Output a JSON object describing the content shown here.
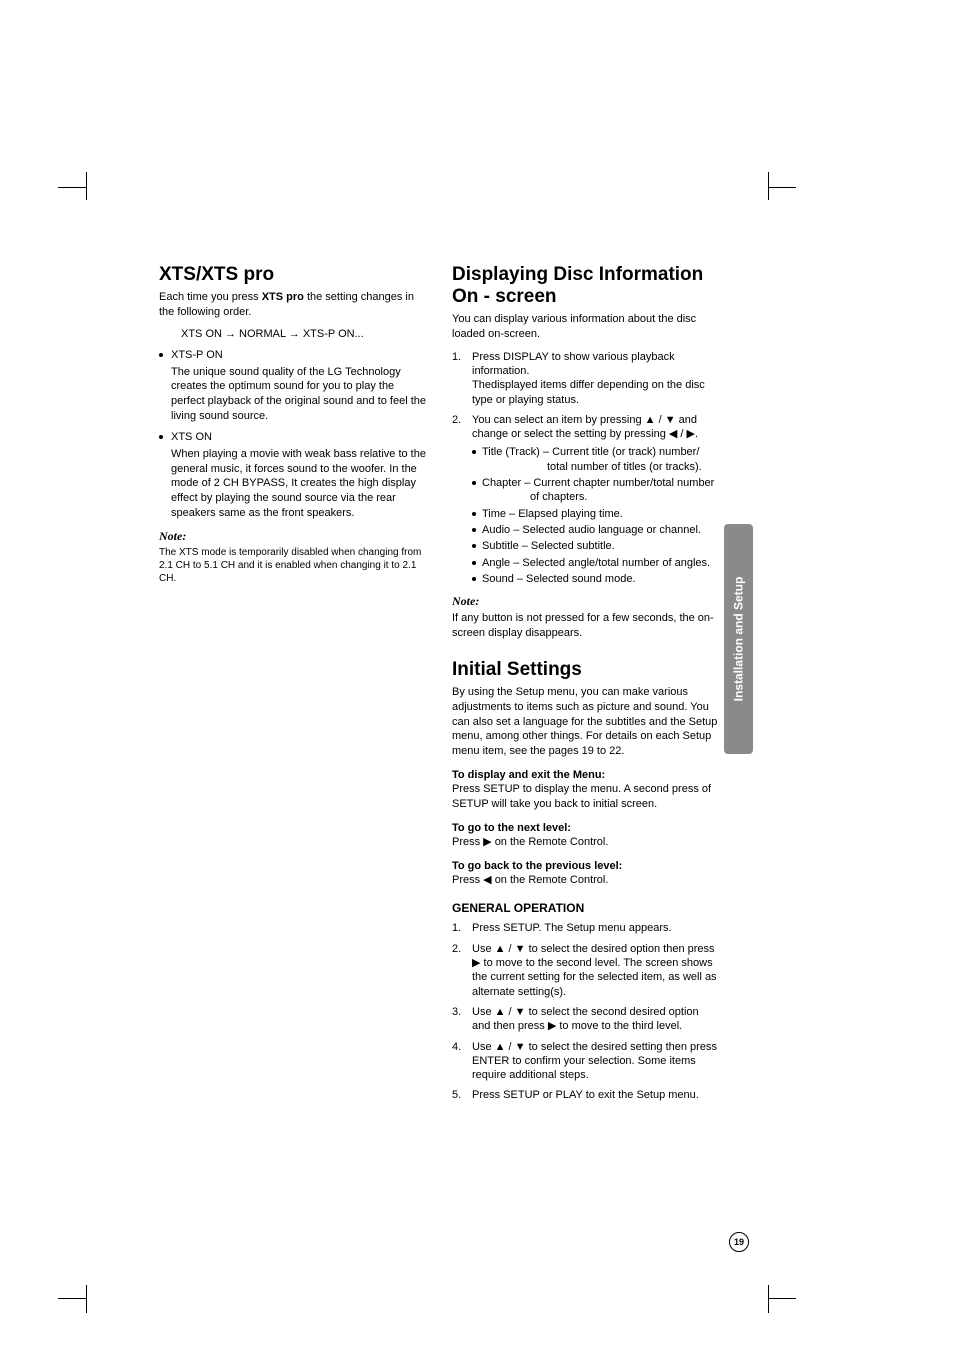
{
  "left": {
    "heading": "XTS/XTS pro",
    "intro": "Each time you press XTS pro the setting changes in the following order.",
    "intro_bold": "XTS pro",
    "sequence": "XTS ON → NORMAL → XTS-P ON...",
    "bullets": [
      {
        "title": "XTS-P ON",
        "desc": "The unique sound quality of the LG Technology creates the optimum sound for you to play the perfect playback of the original sound and to feel the living sound source."
      },
      {
        "title": "XTS ON",
        "desc": "When playing a movie with weak bass relative to the general music, it forces sound to the woofer. In the mode of 2 CH BYPASS, It creates the high display effect by playing the sound source via the rear speakers same as the front speakers."
      }
    ],
    "note_head": "Note:",
    "note_body": "The XTS mode is temporarily disabled when changing from 2.1 CH to 5.1 CH and it is enabled when changing it to 2.1 CH."
  },
  "right": {
    "heading1": "Displaying Disc Information On - screen",
    "intro1": "You can display various information about the disc loaded on-screen.",
    "ol1": [
      {
        "line": "Press DISPLAY to show various playback information.",
        "cont": "Thedisplayed items differ depending on the disc type or playing status."
      },
      {
        "line": "You can select an item by pressing ▲ / ▼ and change or select the setting by pressing ◀ / ▶.",
        "sub": [
          "Title (Track) – Current title (or track) number/ total number of titles (or tracks).",
          "Chapter – Current chapter number/total number of chapters.",
          "Time – Elapsed playing time.",
          "Audio – Selected audio language or channel.",
          "Subtitle – Selected subtitle.",
          "Angle – Selected angle/total number of angles.",
          "Sound – Selected sound mode."
        ]
      }
    ],
    "note_head": "Note:",
    "note_body": "If any button is not pressed for a few seconds, the on-screen display disappears.",
    "heading2": "Initial Settings",
    "intro2": "By using the Setup menu, you can make various adjustments to items such as picture and sound. You can also set a language for the subtitles and the Setup menu, among other things. For details on each Setup menu item, see the pages 19 to 22.",
    "sub1_head": "To display and exit the Menu:",
    "sub1_body": "Press SETUP to display the menu. A second press of SETUP will take you back to initial screen.",
    "sub2_head": "To go to the next level:",
    "sub2_body": "Press ▶ on the Remote Control.",
    "sub3_head": "To go back to the previous level:",
    "sub3_body": "Press ◀ on the Remote Control.",
    "gen_head": "GENERAL OPERATION",
    "gen_ol": [
      "Press SETUP. The Setup menu appears.",
      "Use ▲ / ▼ to select the desired option then press ▶ to move to the second level. The screen shows the current setting for the selected item, as well as alternate setting(s).",
      "Use ▲ / ▼ to select the second desired option and then press ▶ to move to the third level.",
      "Use ▲ / ▼ to select the desired setting then press ENTER to confirm your selection. Some items require additional steps.",
      "Press SETUP or PLAY to exit the Setup menu."
    ]
  },
  "side_tab": "Installation and Setup",
  "page_number": "19"
}
